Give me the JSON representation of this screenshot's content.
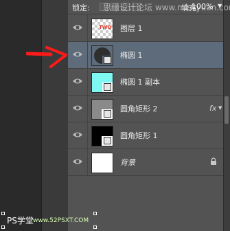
{
  "toolbar": {
    "lock_label": "锁定:",
    "fill_label": "填充:",
    "fill_value": "100%"
  },
  "watermark": "思缘设计论坛 www.missyuan.com",
  "layers": [
    {
      "name": "图层 1",
      "thumb": "checker-with-red-text",
      "selected": false
    },
    {
      "name": "椭圆 1",
      "thumb": "dark-circle",
      "selected": true
    },
    {
      "name": "椭圆 1 副本",
      "thumb": "cyan-shape",
      "selected": false
    },
    {
      "name": "圆角矩形 2",
      "thumb": "gray-rounded",
      "selected": false,
      "fx": "fx"
    },
    {
      "name": "圆角矩形 1",
      "thumb": "black-rounded",
      "selected": false
    },
    {
      "name": "背景",
      "thumb": "white",
      "selected": false,
      "locked": true
    }
  ],
  "bottom_watermark": {
    "text1": "PS学堂",
    "text2": "www.52PSXT.COM"
  },
  "colors": {
    "panel": "#535353",
    "selected_row": "#5d6b7a",
    "arrow": "#ff1a1a",
    "cyan": "#7ff7f3"
  }
}
